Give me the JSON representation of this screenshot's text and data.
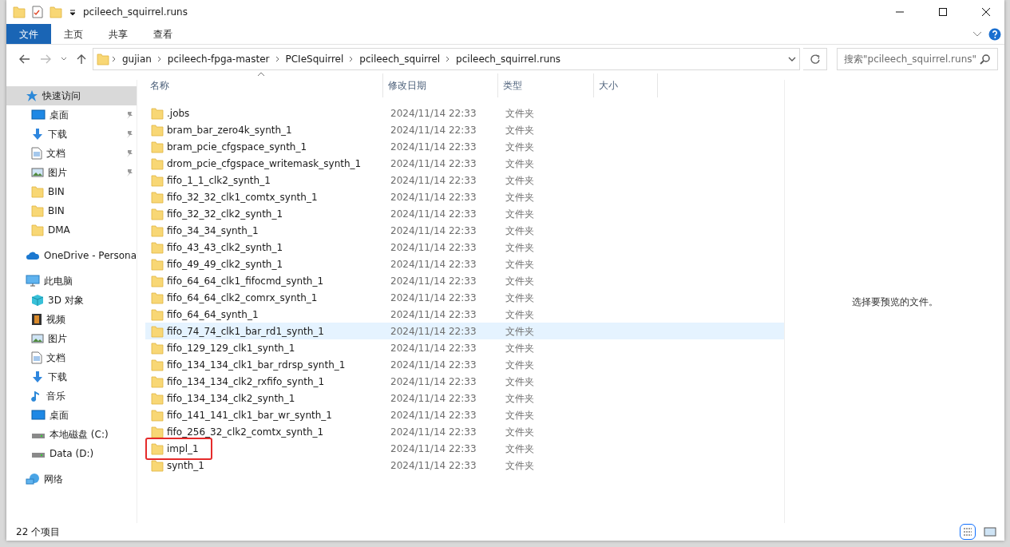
{
  "window": {
    "title": "pcileech_squirrel.runs"
  },
  "ribbon": {
    "tabs": [
      {
        "label": "文件",
        "selected": true
      },
      {
        "label": "主页",
        "selected": false
      },
      {
        "label": "共享",
        "selected": false
      },
      {
        "label": "查看",
        "selected": false
      }
    ]
  },
  "address_bar": {
    "path": [
      "gujian",
      "pcileech-fpga-master",
      "PCIeSquirrel",
      "pcileech_squirrel",
      "pcileech_squirrel.runs"
    ]
  },
  "search": {
    "placeholder": "搜索\"pcileech_squirrel.runs\""
  },
  "sidebar": {
    "items": [
      {
        "label": "快速访问",
        "kind": "star",
        "selected": true,
        "children": [
          {
            "label": "桌面",
            "kind": "desktop",
            "pinned": true,
            "selected": false
          },
          {
            "label": "下载",
            "kind": "download",
            "pinned": true,
            "selected": false
          },
          {
            "label": "文档",
            "kind": "document",
            "pinned": true,
            "selected": false
          },
          {
            "label": "图片",
            "kind": "picture",
            "pinned": true,
            "selected": false
          },
          {
            "label": "BIN",
            "kind": "folder",
            "pinned": false,
            "selected": false
          },
          {
            "label": "BIN",
            "kind": "folder",
            "pinned": false,
            "selected": false
          },
          {
            "label": "DMA",
            "kind": "folder",
            "pinned": false,
            "selected": false
          }
        ]
      },
      {
        "label": "OneDrive - Persona",
        "kind": "cloud",
        "selected": false
      },
      {
        "label": "此电脑",
        "kind": "pc",
        "selected": false,
        "children": [
          {
            "label": "3D 对象",
            "kind": "cube",
            "pinned": false,
            "selected": false
          },
          {
            "label": "视频",
            "kind": "video",
            "pinned": false,
            "selected": false
          },
          {
            "label": "图片",
            "kind": "picture",
            "pinned": false,
            "selected": false
          },
          {
            "label": "文档",
            "kind": "document",
            "pinned": false,
            "selected": false
          },
          {
            "label": "下载",
            "kind": "download",
            "pinned": false,
            "selected": false
          },
          {
            "label": "音乐",
            "kind": "music",
            "pinned": false,
            "selected": false
          },
          {
            "label": "桌面",
            "kind": "desktop",
            "pinned": false,
            "selected": false
          },
          {
            "label": "本地磁盘 (C:)",
            "kind": "drive",
            "pinned": false,
            "selected": false
          },
          {
            "label": "Data (D:)",
            "kind": "drive",
            "pinned": false,
            "selected": false
          }
        ]
      },
      {
        "label": "网络",
        "kind": "network",
        "selected": false
      }
    ]
  },
  "table": {
    "columns": [
      {
        "label": "名称",
        "sorted": true
      },
      {
        "label": "修改日期",
        "sorted": false
      },
      {
        "label": "类型",
        "sorted": false
      },
      {
        "label": "大小",
        "sorted": false
      }
    ],
    "rows": [
      {
        "name": ".jobs",
        "modified": "2024/11/14 22:33",
        "type": "文件夹",
        "hovered": false,
        "marked": false
      },
      {
        "name": "bram_bar_zero4k_synth_1",
        "modified": "2024/11/14 22:33",
        "type": "文件夹",
        "hovered": false,
        "marked": false
      },
      {
        "name": "bram_pcie_cfgspace_synth_1",
        "modified": "2024/11/14 22:33",
        "type": "文件夹",
        "hovered": false,
        "marked": false
      },
      {
        "name": "drom_pcie_cfgspace_writemask_synth_1",
        "modified": "2024/11/14 22:33",
        "type": "文件夹",
        "hovered": false,
        "marked": false
      },
      {
        "name": "fifo_1_1_clk2_synth_1",
        "modified": "2024/11/14 22:33",
        "type": "文件夹",
        "hovered": false,
        "marked": false
      },
      {
        "name": "fifo_32_32_clk1_comtx_synth_1",
        "modified": "2024/11/14 22:33",
        "type": "文件夹",
        "hovered": false,
        "marked": false
      },
      {
        "name": "fifo_32_32_clk2_synth_1",
        "modified": "2024/11/14 22:33",
        "type": "文件夹",
        "hovered": false,
        "marked": false
      },
      {
        "name": "fifo_34_34_synth_1",
        "modified": "2024/11/14 22:33",
        "type": "文件夹",
        "hovered": false,
        "marked": false
      },
      {
        "name": "fifo_43_43_clk2_synth_1",
        "modified": "2024/11/14 22:33",
        "type": "文件夹",
        "hovered": false,
        "marked": false
      },
      {
        "name": "fifo_49_49_clk2_synth_1",
        "modified": "2024/11/14 22:33",
        "type": "文件夹",
        "hovered": false,
        "marked": false
      },
      {
        "name": "fifo_64_64_clk1_fifocmd_synth_1",
        "modified": "2024/11/14 22:33",
        "type": "文件夹",
        "hovered": false,
        "marked": false
      },
      {
        "name": "fifo_64_64_clk2_comrx_synth_1",
        "modified": "2024/11/14 22:33",
        "type": "文件夹",
        "hovered": false,
        "marked": false
      },
      {
        "name": "fifo_64_64_synth_1",
        "modified": "2024/11/14 22:33",
        "type": "文件夹",
        "hovered": false,
        "marked": false
      },
      {
        "name": "fifo_74_74_clk1_bar_rd1_synth_1",
        "modified": "2024/11/14 22:33",
        "type": "文件夹",
        "hovered": true,
        "marked": false
      },
      {
        "name": "fifo_129_129_clk1_synth_1",
        "modified": "2024/11/14 22:33",
        "type": "文件夹",
        "hovered": false,
        "marked": false
      },
      {
        "name": "fifo_134_134_clk1_bar_rdrsp_synth_1",
        "modified": "2024/11/14 22:33",
        "type": "文件夹",
        "hovered": false,
        "marked": false
      },
      {
        "name": "fifo_134_134_clk2_rxfifo_synth_1",
        "modified": "2024/11/14 22:33",
        "type": "文件夹",
        "hovered": false,
        "marked": false
      },
      {
        "name": "fifo_134_134_clk2_synth_1",
        "modified": "2024/11/14 22:33",
        "type": "文件夹",
        "hovered": false,
        "marked": false
      },
      {
        "name": "fifo_141_141_clk1_bar_wr_synth_1",
        "modified": "2024/11/14 22:33",
        "type": "文件夹",
        "hovered": false,
        "marked": false
      },
      {
        "name": "fifo_256_32_clk2_comtx_synth_1",
        "modified": "2024/11/14 22:33",
        "type": "文件夹",
        "hovered": false,
        "marked": false
      },
      {
        "name": "impl_1",
        "modified": "2024/11/14 22:33",
        "type": "文件夹",
        "hovered": false,
        "marked": true
      },
      {
        "name": "synth_1",
        "modified": "2024/11/14 22:33",
        "type": "文件夹",
        "hovered": false,
        "marked": false
      }
    ]
  },
  "preview": {
    "message": "选择要预览的文件。"
  },
  "status_bar": {
    "count": "22 个项目"
  }
}
